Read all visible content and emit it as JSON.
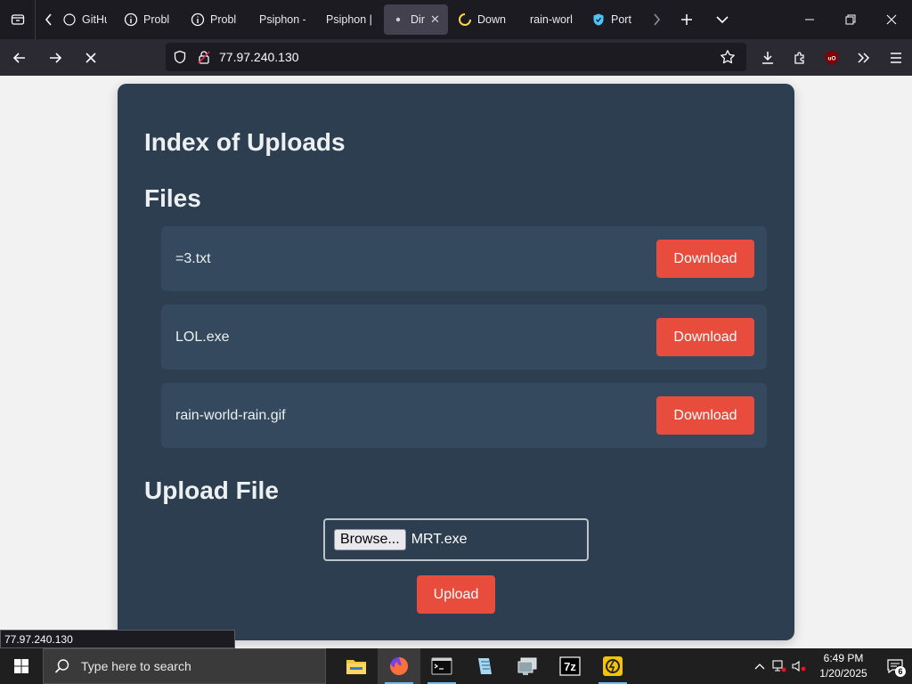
{
  "browser": {
    "tabs": [
      {
        "title": "GitHu",
        "icon": "github-icon"
      },
      {
        "title": "Probl",
        "icon": "info-icon"
      },
      {
        "title": "Probl",
        "icon": "info-icon"
      },
      {
        "title": "Psiphon -",
        "icon": "none"
      },
      {
        "title": "Psiphon |",
        "icon": "none"
      },
      {
        "title": "Dir",
        "icon": "dot-icon",
        "active": true
      },
      {
        "title": "Down",
        "icon": "loading-spinner-icon"
      },
      {
        "title": "rain-worl",
        "icon": "none"
      },
      {
        "title": "Port C",
        "icon": "shield-icon"
      }
    ],
    "url": "77.97.240.130",
    "ublock_label": "uO",
    "accent": "#e74c3c"
  },
  "page": {
    "title": "Index of Uploads",
    "files_heading": "Files",
    "files": [
      {
        "name": "=3.txt",
        "action": "Download"
      },
      {
        "name": "LOL.exe",
        "action": "Download"
      },
      {
        "name": "rain-world-rain.gif",
        "action": "Download"
      }
    ],
    "upload_heading": "Upload File",
    "browse_label": "Browse...",
    "chosen_file": "MRT.exe",
    "upload_label": "Upload"
  },
  "status_url": "77.97.240.130",
  "taskbar": {
    "search_placeholder": "Type here to search",
    "apps": [
      "file-explorer-icon",
      "firefox-icon",
      "terminal-icon",
      "notepad-icon",
      "remote-desktop-icon",
      "7zip-icon",
      "power-icon"
    ],
    "time": "6:49 PM",
    "date": "1/20/2025",
    "notification_count": "6",
    "sevenzip_label": "7z"
  }
}
